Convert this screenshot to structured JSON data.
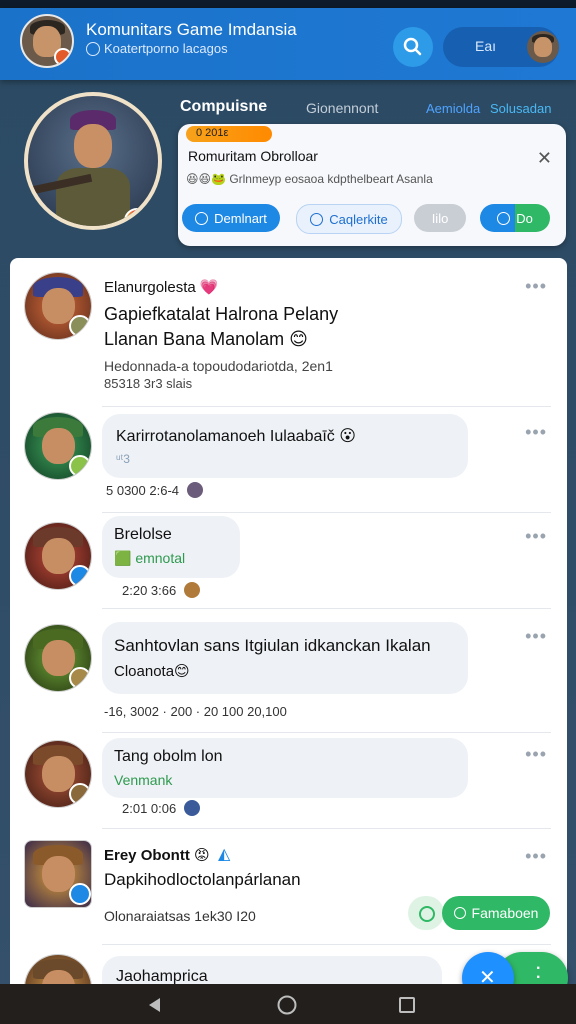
{
  "header": {
    "title": "Komunitars Game Imdansia",
    "subtitle": "Koatertporno lacagos",
    "pill_label": "Eaı"
  },
  "hero": {
    "tabs": [
      "Compuisne",
      "Gionennont",
      "Aemiolda",
      "Solusadan"
    ],
    "card": {
      "badge": "0      201ε",
      "title": "Romuritam Obrolloar",
      "emoji_row": "😆😆🐸",
      "description": "Grlnmeyp eosaoa kdpthelbeart Asanla",
      "buttons": [
        "Demlnart",
        "Caqlerkite",
        "Iilo",
        "Do"
      ]
    }
  },
  "feed": [
    {
      "name": "Elanurgolesta 💗",
      "line1": "Gapiefkatalat Halrona Pelany",
      "line2": "Llanan Bana Manolam 😊",
      "line3": "Hedonnada-a topoudodariotda, 2en1",
      "ts": "85318 3r3 slais"
    },
    {
      "text": "Karirrotanolamanoeh Iulaabaīč 😮",
      "sub": "ᵘᵗ3",
      "ts": "5 0300  2:6-4"
    },
    {
      "text": "Brelolse",
      "sub": "🟩 emnotal",
      "ts": "2:20  3:66"
    },
    {
      "text": "Sanhtovlan sans Itgiulan idkanckan Ikalan",
      "sub": "Cloanota😊",
      "ts": "-16, 3002  ·  200 · 20 100  20,100"
    },
    {
      "text": "Tang obolm lon",
      "sub": "Venmank",
      "ts": "2:01  0:06"
    },
    {
      "name": "Erey Obontt 😡",
      "line1": "Dapkihodloctolanpárlanan",
      "ts": "Olonaraiatsas  1ek30 I20",
      "action": "Famaboen"
    },
    {
      "text": "Jaohamprica"
    }
  ],
  "colors": {
    "header_blue": "#1b72c9",
    "accent_green": "#2fb865",
    "accent_blue": "#1e88e5",
    "fab_blue": "#1e90ff"
  },
  "icons": [
    "search-icon",
    "back-icon",
    "home-icon",
    "recents-icon",
    "close-icon",
    "more-icon"
  ]
}
